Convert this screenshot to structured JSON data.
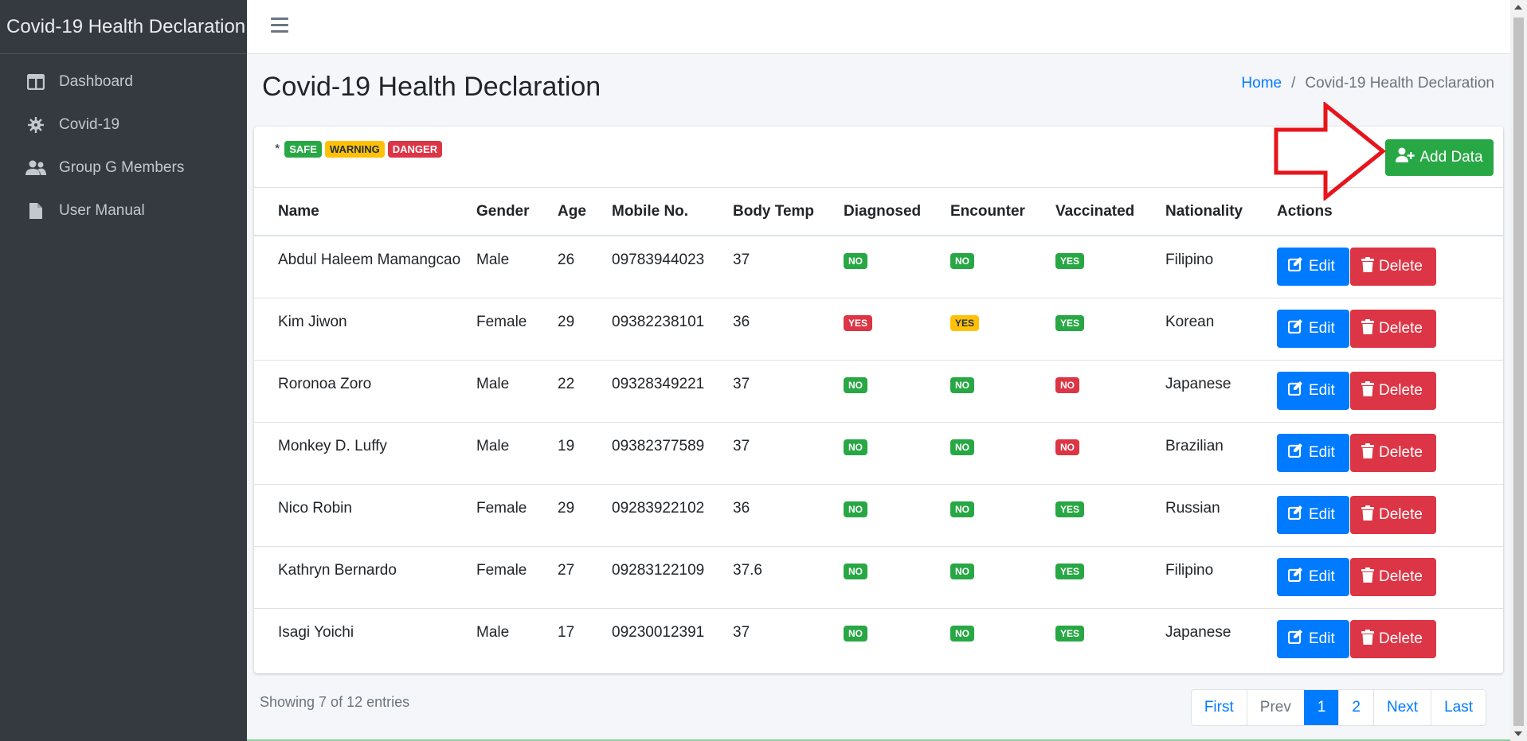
{
  "brand": "Covid-19 Health Declaration",
  "sidebar": {
    "items": [
      {
        "label": "Dashboard",
        "icon": "dashboard-icon"
      },
      {
        "label": "Covid-19",
        "icon": "virus-icon"
      },
      {
        "label": "Group G Members",
        "icon": "users-icon"
      },
      {
        "label": "User Manual",
        "icon": "file-icon"
      }
    ]
  },
  "page": {
    "title": "Covid-19 Health Declaration",
    "breadcrumb": {
      "home": "Home",
      "separator": "/",
      "current": "Covid-19 Health Declaration"
    }
  },
  "legend": {
    "star": "*",
    "safe": "SAFE",
    "warning": "WARNING",
    "danger": "DANGER"
  },
  "add_button": "Add Data",
  "table": {
    "headers": [
      "Name",
      "Gender",
      "Age",
      "Mobile No.",
      "Body Temp",
      "Diagnosed",
      "Encounter",
      "Vaccinated",
      "Nationality",
      "Actions"
    ],
    "rows": [
      {
        "name": "Abdul Haleem Mamangcao",
        "gender": "Male",
        "age": "26",
        "mobile": "09783944023",
        "temp": "37",
        "diagnosed": "NO",
        "encounter": "NO",
        "vaccinated": "YES",
        "nationality": "Filipino"
      },
      {
        "name": "Kim Jiwon",
        "gender": "Female",
        "age": "29",
        "mobile": "09382238101",
        "temp": "36",
        "diagnosed": "YES",
        "encounter": "YES",
        "vaccinated": "YES",
        "nationality": "Korean"
      },
      {
        "name": "Roronoa Zoro",
        "gender": "Male",
        "age": "22",
        "mobile": "09328349221",
        "temp": "37",
        "diagnosed": "NO",
        "encounter": "NO",
        "vaccinated": "NO",
        "nationality": "Japanese"
      },
      {
        "name": "Monkey D. Luffy",
        "gender": "Male",
        "age": "19",
        "mobile": "09382377589",
        "temp": "37",
        "diagnosed": "NO",
        "encounter": "NO",
        "vaccinated": "NO",
        "nationality": "Brazilian"
      },
      {
        "name": "Nico Robin",
        "gender": "Female",
        "age": "29",
        "mobile": "09283922102",
        "temp": "36",
        "diagnosed": "NO",
        "encounter": "NO",
        "vaccinated": "YES",
        "nationality": "Russian"
      },
      {
        "name": "Kathryn Bernardo",
        "gender": "Female",
        "age": "27",
        "mobile": "09283122109",
        "temp": "37.6",
        "diagnosed": "NO",
        "encounter": "NO",
        "vaccinated": "YES",
        "nationality": "Filipino"
      },
      {
        "name": "Isagi Yoichi",
        "gender": "Male",
        "age": "17",
        "mobile": "09230012391",
        "temp": "37",
        "diagnosed": "NO",
        "encounter": "NO",
        "vaccinated": "YES",
        "nationality": "Japanese"
      }
    ],
    "edit_label": "Edit",
    "delete_label": "Delete"
  },
  "footer": {
    "showing": "Showing 7 of 12 entries",
    "pages": [
      "First",
      "Prev",
      "1",
      "2",
      "Next",
      "Last"
    ]
  },
  "colors": {
    "sidebar": "#343a40",
    "primary": "#007bff",
    "success": "#28a745",
    "danger": "#dc3545",
    "warning": "#ffc107",
    "annotation": "#e8141b"
  }
}
